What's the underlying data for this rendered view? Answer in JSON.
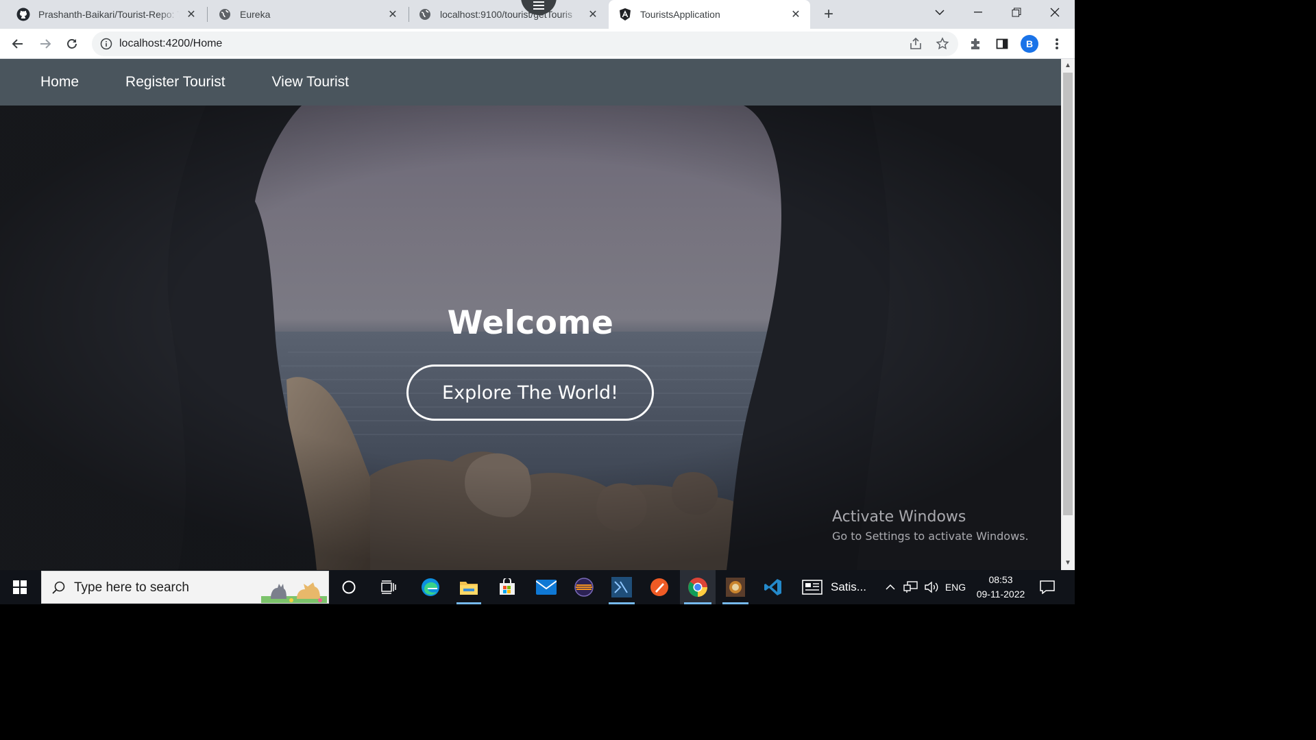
{
  "browser": {
    "tabs": [
      {
        "title": "Prashanth-Baikari/Tourist-Repo: T",
        "icon": "github-icon"
      },
      {
        "title": "Eureka",
        "icon": "globe-icon"
      },
      {
        "title": "localhost:9100/tourist/getTouris",
        "icon": "globe-icon"
      },
      {
        "title": "TouristsApplication",
        "icon": "angular-icon",
        "active": true
      }
    ],
    "url": "localhost:4200/Home",
    "profile_initial": "B"
  },
  "app": {
    "nav": [
      {
        "label": "Home"
      },
      {
        "label": "Register Tourist"
      },
      {
        "label": "View Tourist"
      }
    ],
    "hero": {
      "heading": "Welcome",
      "button_label": "Explore The World!"
    },
    "colors": {
      "navbar": "#4a555d",
      "text": "#ffffff"
    }
  },
  "watermark": {
    "line1": "Activate Windows",
    "line2": "Go to Settings to activate Windows."
  },
  "taskbar": {
    "search_placeholder": "Type here to search",
    "news_label": "Satis...",
    "language": "ENG",
    "time": "08:53",
    "date": "09-11-2022"
  }
}
